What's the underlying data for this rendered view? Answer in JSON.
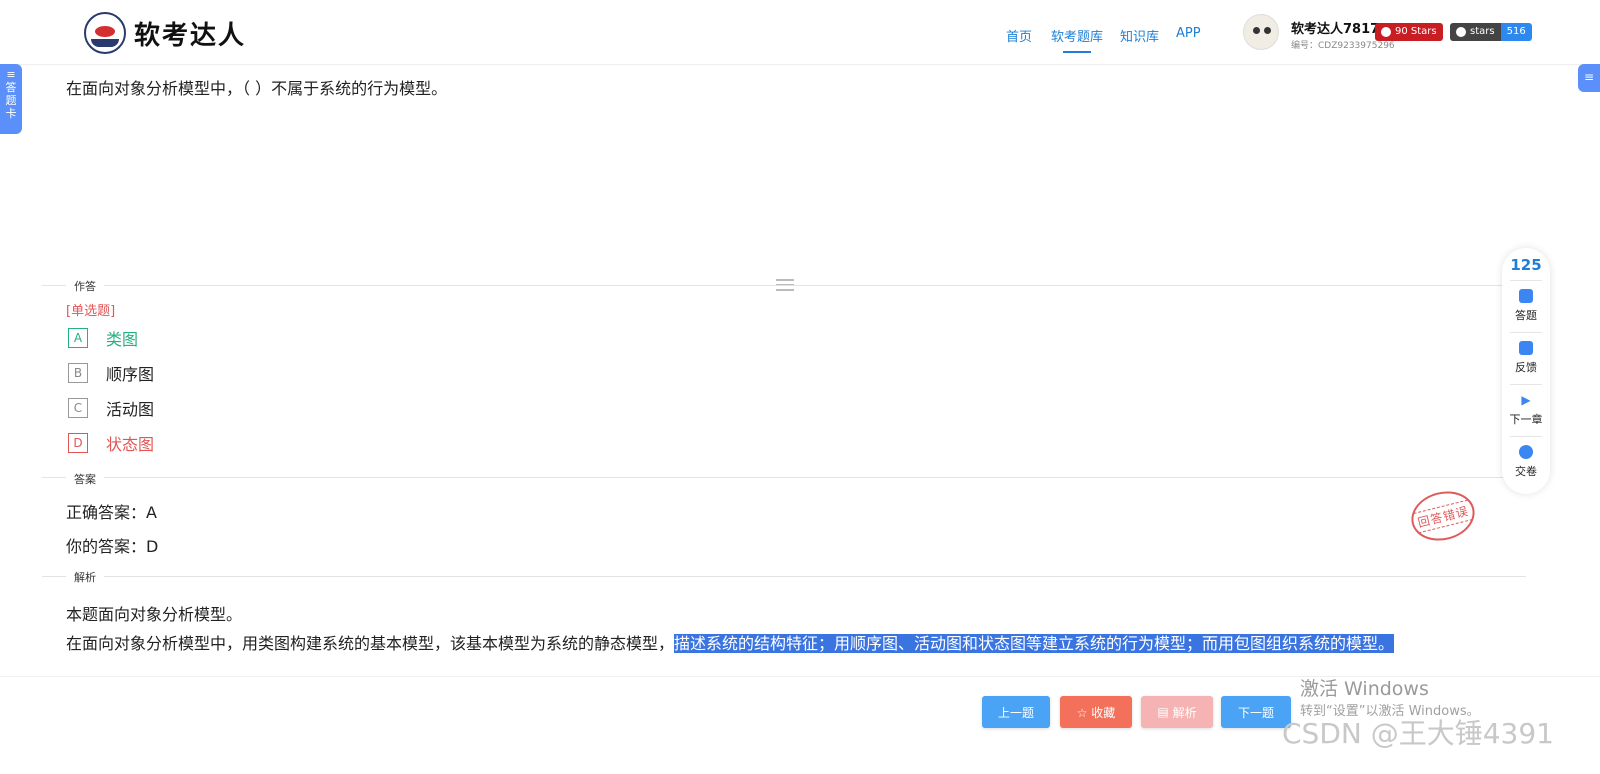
{
  "header": {
    "logo_text": "软考达人",
    "nav": [
      "首页",
      "软考题库",
      "知识库",
      "APP"
    ],
    "active_nav": "软考题库",
    "user_name": "软考达人7817",
    "user_id": "编号：CDZ9233975296",
    "badge_stars_label": "90 Stars",
    "badge_github_label": "stars",
    "badge_github_count": "516"
  },
  "left_tab": {
    "label": "答题卡"
  },
  "question": {
    "text": "在面向对象分析模型中，（ ）不属于系统的行为模型。",
    "type_label": "[单选题]"
  },
  "sections": {
    "answer": "作答",
    "result": "答案",
    "analysis": "解析"
  },
  "options": [
    {
      "letter": "A",
      "text": "类图",
      "state": "correct"
    },
    {
      "letter": "B",
      "text": "顺序图",
      "state": "normal"
    },
    {
      "letter": "C",
      "text": "活动图",
      "state": "normal"
    },
    {
      "letter": "D",
      "text": "状态图",
      "state": "wrong"
    }
  ],
  "answer": {
    "correct": "正确答案：A",
    "yours": "你的答案：D",
    "stamp": "回答错误"
  },
  "analysis": {
    "line1": "本题面向对象分析模型。",
    "line2_plain": "在面向对象分析模型中，用类图构建系统的基本模型，该基本模型为系统的静态模型，",
    "line2_highlight": "描述系统的结构特征；用顺序图、活动图和状态图等建立系统的行为模型；而用包图组织系统的模型。"
  },
  "side_panel": {
    "count": "125",
    "items": [
      "答题",
      "反馈",
      "下一章",
      "交卷"
    ]
  },
  "buttons": {
    "prev": "上一题",
    "favorite": "☆ 收藏",
    "analysis": "解析",
    "next": "下一题"
  },
  "watermarks": {
    "activate_title": "激活 Windows",
    "activate_sub": "转到“设置”以激活 Windows。",
    "csdn": "CSDN @王大锤4391"
  },
  "colors": {
    "accent": "#1e7fd6",
    "correct": "#26b07e",
    "wrong": "#e25555",
    "btn_blue": "#4aa3f5",
    "btn_red": "#f3705a",
    "btn_pink": "#f5b3b3"
  }
}
